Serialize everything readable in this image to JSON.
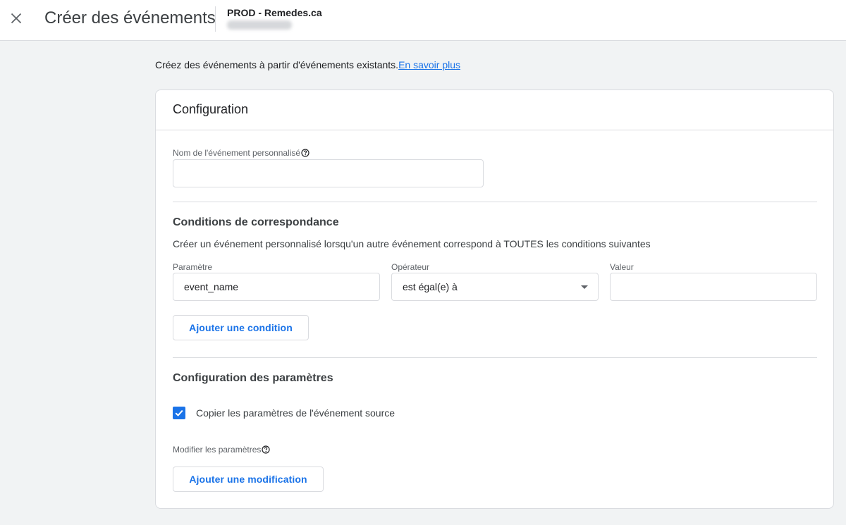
{
  "header": {
    "close_icon": "close-icon",
    "title": "Créer des événements",
    "property_name": "PROD - Remedes.ca"
  },
  "intro": {
    "text": "Créez des événements à partir d'événements existants.",
    "link": "En savoir plus"
  },
  "configuration": {
    "title": "Configuration",
    "custom_event_name": {
      "label": "Nom de l'événement personnalisé",
      "help_icon": "help-icon",
      "value": ""
    },
    "matching": {
      "title": "Conditions de correspondance",
      "description": "Créer un événement personnalisé lorsqu'un autre événement correspond à TOUTES les conditions suivantes",
      "parameter_label": "Paramètre",
      "parameter_value": "event_name",
      "operator_label": "Opérateur",
      "operator_value": "est égal(e) à",
      "value_label": "Valeur",
      "value_value": "",
      "add_condition": "Ajouter une condition"
    },
    "params": {
      "title": "Configuration des paramètres",
      "copy_checkbox_label": "Copier les paramètres de l'événement source",
      "copy_checked": true,
      "modify_label": "Modifier les paramètres",
      "help_icon": "help-icon",
      "add_modification": "Ajouter une modification"
    }
  },
  "colors": {
    "accent": "#1a73e8",
    "background": "#f1f3f4",
    "border": "#dadce0"
  }
}
